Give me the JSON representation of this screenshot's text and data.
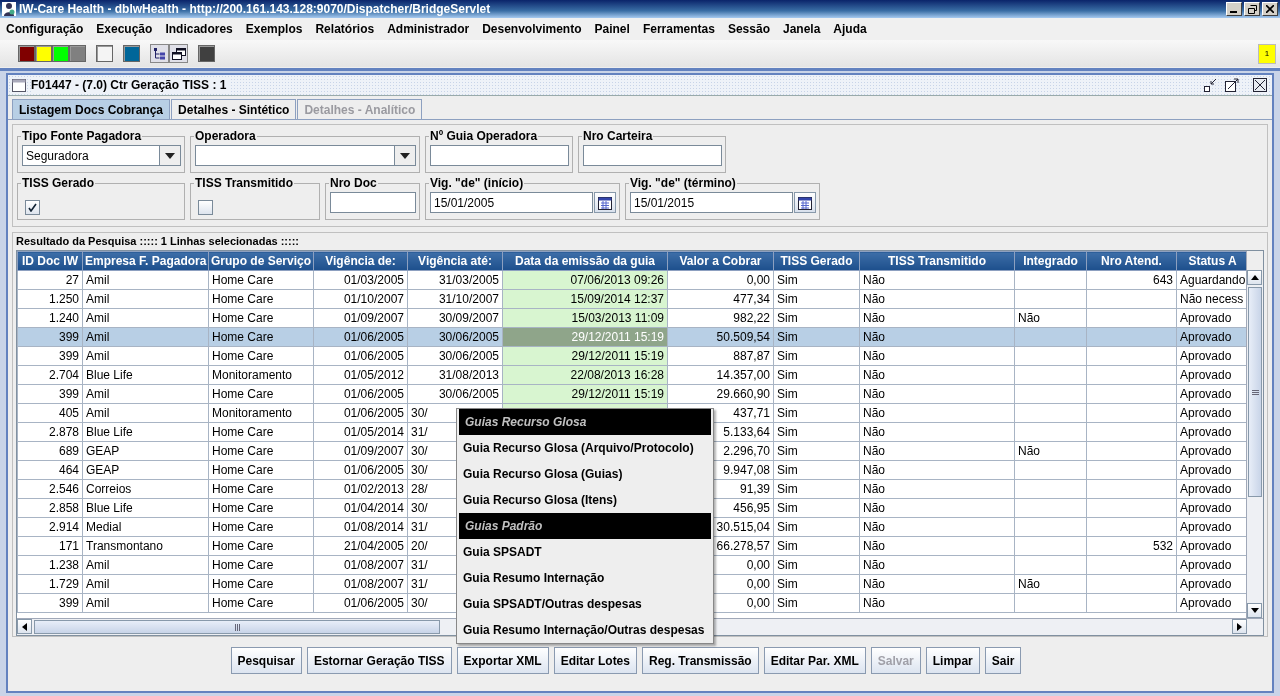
{
  "window": {
    "title": "IW-Care Health - dbIwHealth - http://200.161.143.128:9070/Dispatcher/BridgeServlet"
  },
  "menu": [
    "Configuração",
    "Execução",
    "Indicadores",
    "Exemplos",
    "Relatórios",
    "Administrador",
    "Desenvolvimento",
    "Painel",
    "Ferramentas",
    "Sessão",
    "Janela",
    "Ajuda"
  ],
  "toolbar": [
    {
      "kind": "swatch",
      "color": "#800000"
    },
    {
      "kind": "swatch",
      "color": "#ffff00"
    },
    {
      "kind": "swatch",
      "color": "#00ff00"
    },
    {
      "kind": "swatch",
      "color": "#808080"
    },
    {
      "kind": "swatch",
      "color": "#f4f4f4"
    },
    {
      "kind": "swatch",
      "color": "#006699"
    },
    {
      "kind": "tree"
    },
    {
      "kind": "windows"
    },
    {
      "kind": "swatch",
      "color": "#404040"
    }
  ],
  "notification_badge": "1",
  "frame": {
    "title": "F01447 - (7.0) Ctr Geração TISS : 1"
  },
  "tabs": [
    {
      "label": "Listagem Docs Cobrança",
      "selected": true,
      "disabled": false
    },
    {
      "label": "Detalhes - Sintético",
      "selected": false,
      "disabled": false
    },
    {
      "label": "Detalhes - Analítico",
      "selected": false,
      "disabled": true
    }
  ],
  "filter_rows": [
    [
      {
        "kind": "combo",
        "label": "Tipo Fonte Pagadora",
        "value": "Seguradora"
      },
      {
        "kind": "combo",
        "label": "Operadora"
      },
      {
        "kind": "text",
        "label": "Nº Guia Operadora"
      },
      {
        "kind": "text",
        "label": "Nro Carteira"
      }
    ],
    [
      {
        "kind": "checkbox",
        "label": "TISS Gerado",
        "checked": true
      },
      {
        "kind": "checkbox",
        "label": "TISS Transmitido",
        "checked": false
      },
      {
        "kind": "text",
        "label": "Nro Doc"
      },
      {
        "kind": "date",
        "label": "Vig. \"de\" (início)",
        "value": "15/01/2005"
      },
      {
        "kind": "date",
        "label": "Vig. \"de\" (término)",
        "value": "15/01/2015"
      }
    ]
  ],
  "results": {
    "title": "Resultado da Pesquisa ::::: 1 Linhas selecionadas :::::",
    "columns": [
      {
        "label": "ID Doc IW"
      },
      {
        "label": "Empresa F. Pagadora"
      },
      {
        "label": "Grupo de Serviço"
      },
      {
        "label": "Vigência de:"
      },
      {
        "label": "Vigência até:"
      },
      {
        "label": "Data da emissão da guia"
      },
      {
        "label": "Valor a Cobrar"
      },
      {
        "label": "TISS Gerado"
      },
      {
        "label": "TISS Transmitido"
      },
      {
        "label": "Integrado"
      },
      {
        "label": "Nro Atend."
      },
      {
        "label": "Status A"
      }
    ],
    "rows": [
      {
        "selected": false,
        "cells": [
          "27",
          "Amil",
          "Home Care",
          "01/03/2005",
          "31/03/2005",
          "07/06/2013 09:26",
          "0,00",
          "Sim",
          "Não",
          null,
          "643",
          "Aguardando"
        ]
      },
      {
        "selected": false,
        "cells": [
          "1.250",
          "Amil",
          "Home Care",
          "01/10/2007",
          "31/10/2007",
          "15/09/2014 12:37",
          "477,34",
          "Sim",
          "Não",
          null,
          null,
          "Não necess"
        ]
      },
      {
        "selected": false,
        "cells": [
          "1.240",
          "Amil",
          "Home Care",
          "01/09/2007",
          "30/09/2007",
          "15/03/2013 11:09",
          "982,22",
          "Sim",
          "Não",
          "Não",
          null,
          "Aprovado"
        ]
      },
      {
        "selected": true,
        "cells": [
          "399",
          "Amil",
          "Home Care",
          "01/06/2005",
          "30/06/2005",
          "29/12/2011 15:19",
          "50.509,54",
          "Sim",
          "Não",
          null,
          null,
          "Aprovado"
        ]
      },
      {
        "selected": false,
        "cells": [
          "399",
          "Amil",
          "Home Care",
          "01/06/2005",
          "30/06/2005",
          "29/12/2011 15:19",
          "887,87",
          "Sim",
          "Não",
          null,
          null,
          "Aprovado"
        ]
      },
      {
        "selected": false,
        "cells": [
          "2.704",
          "Blue Life",
          "Monitoramento",
          "01/05/2012",
          "31/08/2013",
          "22/08/2013 16:28",
          "14.357,00",
          "Sim",
          "Não",
          null,
          null,
          "Aprovado"
        ]
      },
      {
        "selected": false,
        "cells": [
          "399",
          "Amil",
          "Home Care",
          "01/06/2005",
          "30/06/2005",
          "29/12/2011 15:19",
          "29.660,90",
          "Sim",
          "Não",
          null,
          null,
          "Aprovado"
        ]
      },
      {
        "selected": false,
        "cells": [
          "405",
          "Amil",
          "Monitoramento",
          "01/06/2005",
          {
            "text": "30/",
            "clipped": true
          },
          null,
          "437,71",
          "Sim",
          "Não",
          null,
          null,
          "Aprovado"
        ]
      },
      {
        "selected": false,
        "cells": [
          "2.878",
          "Blue Life",
          "Home Care",
          "01/05/2014",
          {
            "text": "31/",
            "clipped": true
          },
          null,
          "5.133,64",
          "Sim",
          "Não",
          null,
          null,
          "Aprovado"
        ]
      },
      {
        "selected": false,
        "cells": [
          "689",
          "GEAP",
          "Home Care",
          "01/09/2007",
          {
            "text": "30/",
            "clipped": true
          },
          null,
          "2.296,70",
          "Sim",
          "Não",
          "Não",
          null,
          "Aprovado"
        ]
      },
      {
        "selected": false,
        "cells": [
          "464",
          "GEAP",
          "Home Care",
          "01/06/2005",
          {
            "text": "30/",
            "clipped": true
          },
          null,
          "9.947,08",
          "Sim",
          "Não",
          null,
          null,
          "Aprovado"
        ]
      },
      {
        "selected": false,
        "cells": [
          "2.546",
          "Correios",
          "Home Care",
          "01/02/2013",
          {
            "text": "28/",
            "clipped": true
          },
          null,
          "91,39",
          "Sim",
          "Não",
          null,
          null,
          "Aprovado"
        ]
      },
      {
        "selected": false,
        "cells": [
          "2.858",
          "Blue Life",
          "Home Care",
          "01/04/2014",
          {
            "text": "30/",
            "clipped": true
          },
          null,
          "456,95",
          "Sim",
          "Não",
          null,
          null,
          "Aprovado"
        ]
      },
      {
        "selected": false,
        "cells": [
          "2.914",
          "Medial",
          "Home Care",
          "01/08/2014",
          {
            "text": "31/",
            "clipped": true
          },
          null,
          "30.515,04",
          "Sim",
          "Não",
          null,
          null,
          "Aprovado"
        ]
      },
      {
        "selected": false,
        "cells": [
          "171",
          "Transmontano",
          "Home Care",
          "21/04/2005",
          {
            "text": "20/",
            "clipped": true
          },
          null,
          "66.278,57",
          "Sim",
          "Não",
          null,
          "532",
          "Aprovado"
        ]
      },
      {
        "selected": false,
        "cells": [
          "1.238",
          "Amil",
          "Home Care",
          "01/08/2007",
          {
            "text": "31/",
            "clipped": true
          },
          null,
          "0,00",
          "Sim",
          "Não",
          null,
          null,
          "Aprovado"
        ]
      },
      {
        "selected": false,
        "cells": [
          "1.729",
          "Amil",
          "Home Care",
          "01/08/2007",
          {
            "text": "31/",
            "clipped": true
          },
          null,
          "0,00",
          "Sim",
          "Não",
          "Não",
          null,
          "Aprovado"
        ]
      },
      {
        "selected": false,
        "cells": [
          "399",
          "Amil",
          "Home Care",
          "01/06/2005",
          {
            "text": "30/",
            "clipped": true
          },
          null,
          "0,00",
          "Sim",
          "Não",
          null,
          null,
          "Aprovado"
        ]
      }
    ]
  },
  "context_menu": [
    {
      "kind": "header",
      "label": "Guias Recurso Glosa"
    },
    {
      "kind": "item",
      "label": "Guia Recurso Glosa (Arquivo/Protocolo)"
    },
    {
      "kind": "item",
      "label": "Guia Recurso Glosa (Guias)"
    },
    {
      "kind": "item",
      "label": "Guia Recurso Glosa (Itens)"
    },
    {
      "kind": "header",
      "label": "Guias Padrão"
    },
    {
      "kind": "item",
      "label": "Guia SPSADT"
    },
    {
      "kind": "item",
      "label": "Guia Resumo Internação"
    },
    {
      "kind": "item",
      "label": "Guia SPSADT/Outras despesas"
    },
    {
      "kind": "item",
      "label": "Guia Resumo Internação/Outras despesas"
    }
  ],
  "buttons": [
    {
      "label": "Pesquisar",
      "disabled": false
    },
    {
      "label": "Estornar Geração TISS",
      "disabled": false
    },
    {
      "label": "Exportar XML",
      "disabled": false
    },
    {
      "label": "Editar Lotes",
      "disabled": false
    },
    {
      "label": "Reg. Transmissão",
      "disabled": false
    },
    {
      "label": "Editar Par. XML",
      "disabled": false
    },
    {
      "label": "Salvar",
      "disabled": true
    },
    {
      "label": "Limpar",
      "disabled": false
    },
    {
      "label": "Sair",
      "disabled": false
    }
  ]
}
